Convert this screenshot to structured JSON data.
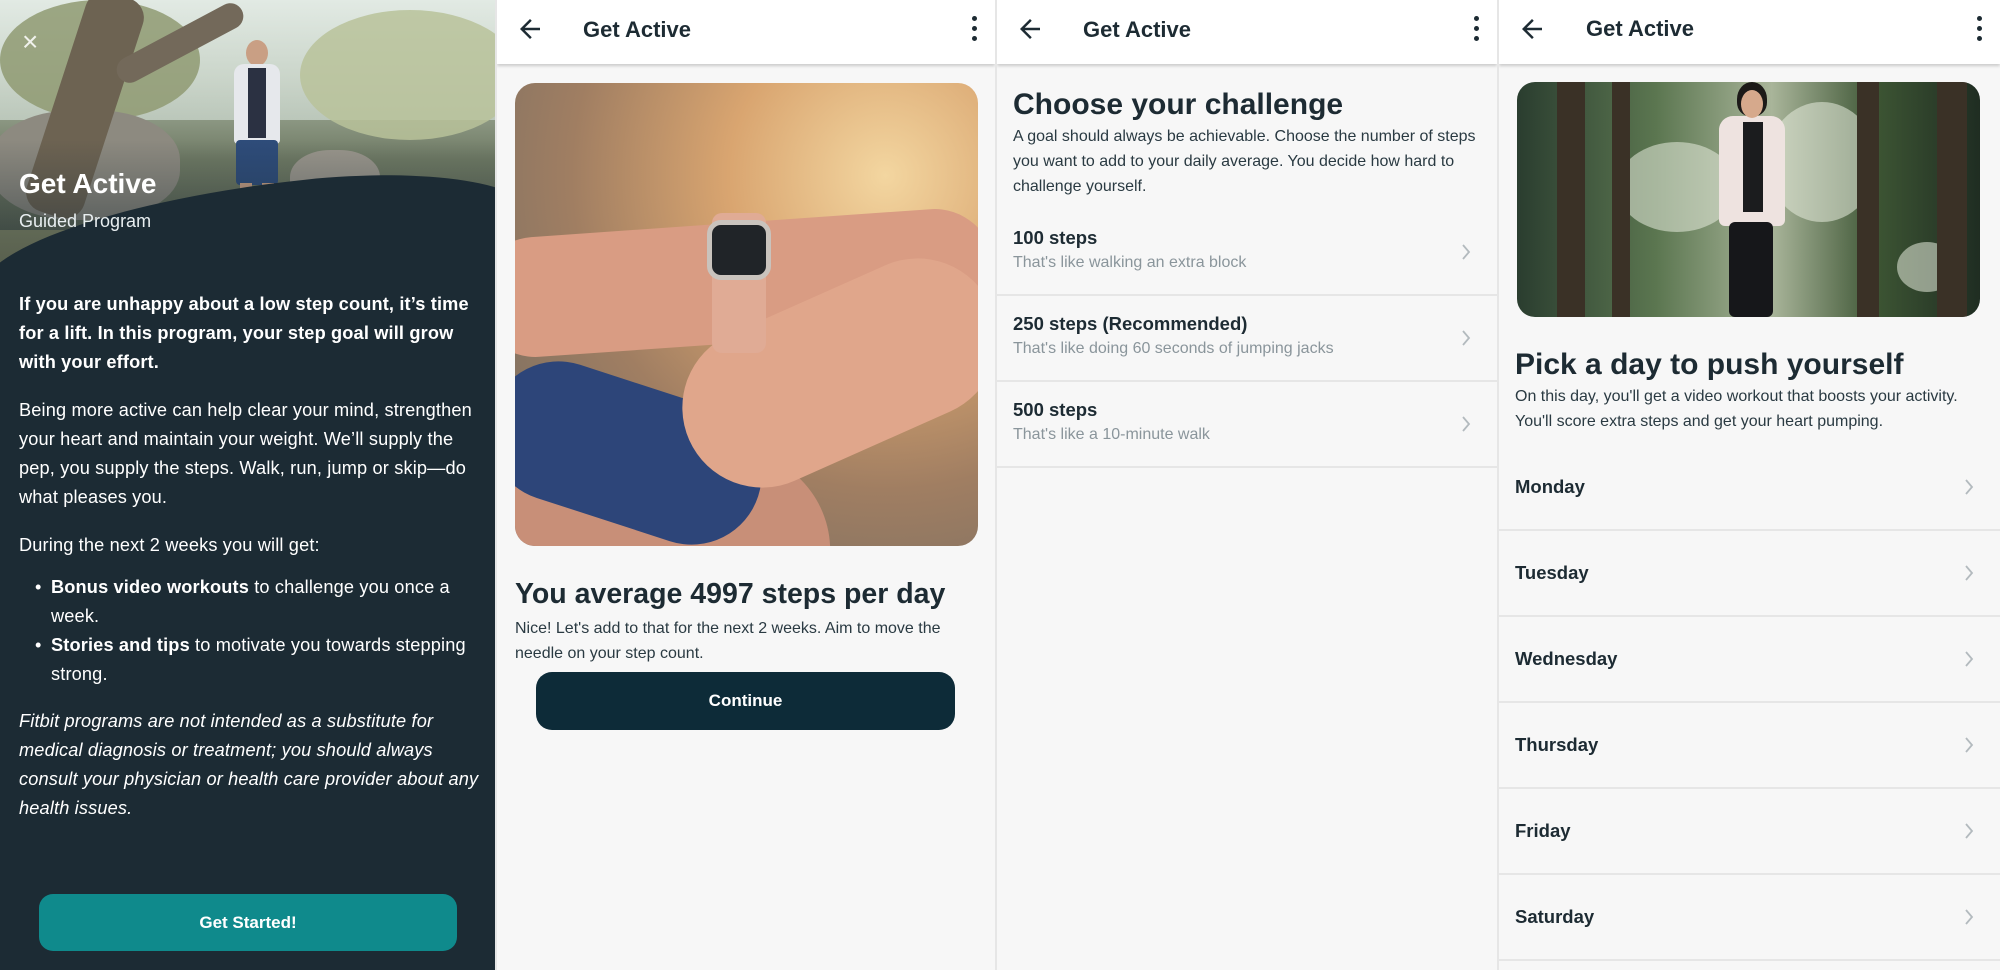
{
  "panel1": {
    "title": "Get Active",
    "subtitle": "Guided Program",
    "lead": "If you are unhappy about a low step count, it’s time for a lift. In this program, your step goal will grow with your effort.",
    "paragraph": "Being more active can help clear your mind, strengthen your heart and maintain your weight. We’ll supply the pep, you supply the steps. Walk, run, jump or skip—do what pleases you.",
    "list_intro": "During the next 2 weeks you will get:",
    "bullets": [
      {
        "bold": "Bonus video workouts",
        "rest": " to challenge you once a week."
      },
      {
        "bold": "Stories and tips",
        "rest": " to motivate you towards stepping strong."
      }
    ],
    "disclaimer": "Fitbit programs are not intended as a substitute for medical diagnosis or treatment; you should always consult your physician or health care provider about any health issues.",
    "button": "Get Started!",
    "close_icon": "×"
  },
  "appbar": {
    "title": "Get Active",
    "back_icon": "arrow-back-icon",
    "more_icon": "more-vert-icon"
  },
  "panel2": {
    "heading": "You average 4997 steps per day",
    "description": "Nice! Let's add to that for the next 2 weeks. Aim to move the needle on your step count.",
    "button": "Continue"
  },
  "panel3": {
    "heading": "Choose your challenge",
    "description": "A goal should always be achievable. Choose the number of steps you want to add to your daily average. You decide how hard to challenge yourself.",
    "options": [
      {
        "title": "100 steps",
        "subtitle": "That's like walking an extra block"
      },
      {
        "title": "250 steps (Recommended)",
        "subtitle": "That's like doing 60 seconds of jumping jacks"
      },
      {
        "title": "500 steps",
        "subtitle": "That's like a 10-minute walk"
      }
    ]
  },
  "panel4": {
    "heading": "Pick a day to push yourself",
    "description": "On this day, you'll get a video workout that boosts your activity. You'll score extra steps and get your heart pumping.",
    "days": [
      "Monday",
      "Tuesday",
      "Wednesday",
      "Thursday",
      "Friday",
      "Saturday"
    ]
  },
  "colors": {
    "dark_panel": "#1c2b34",
    "teal_button": "#0f8a8c",
    "navy_button": "#0d2b38",
    "text_dark": "#1d2b33",
    "text_muted": "#8a959b"
  }
}
